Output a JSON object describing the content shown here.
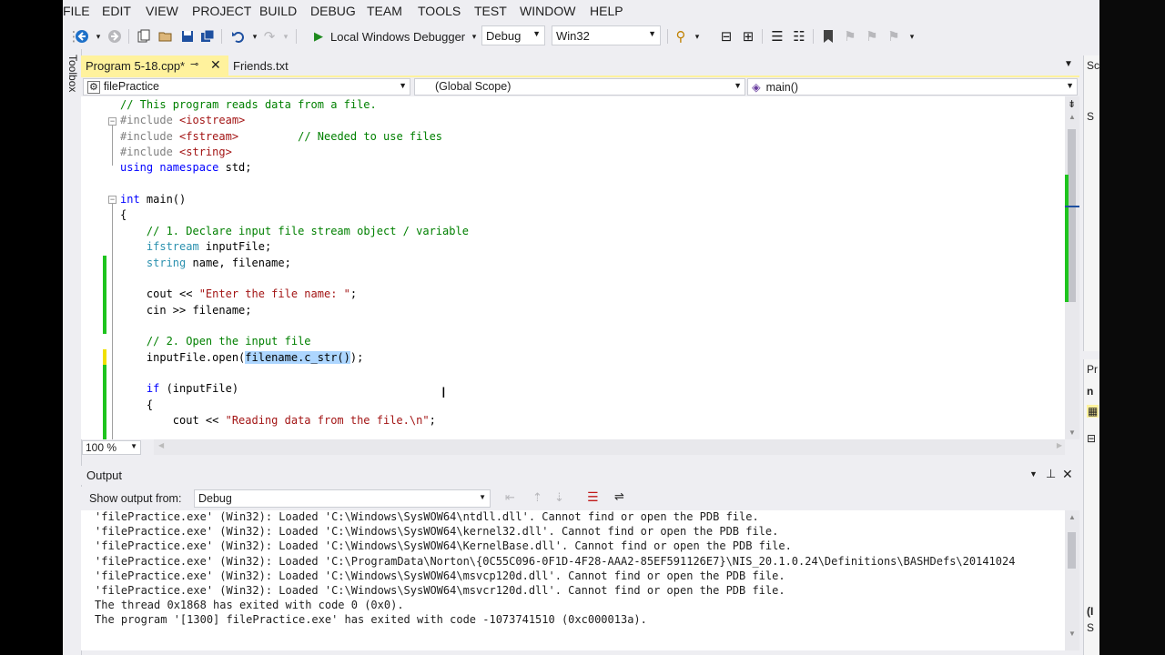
{
  "menu": [
    "FILE",
    "EDIT",
    "VIEW",
    "PROJECT",
    "BUILD",
    "DEBUG",
    "TEAM",
    "TOOLS",
    "TEST",
    "WINDOW",
    "HELP"
  ],
  "toolbar": {
    "run_label": "Local Windows Debugger",
    "config": "Debug",
    "platform": "Win32"
  },
  "toolbox_label": "Toolbox",
  "tabs": {
    "active": "Program 5-18.cpp*",
    "inactive": "Friends.txt"
  },
  "nav": {
    "project": "filePractice",
    "scope": "(Global Scope)",
    "member": "main()"
  },
  "code": [
    {
      "parts": [
        {
          "c": "cm",
          "t": "// This program reads data from a file."
        }
      ]
    },
    {
      "parts": [
        {
          "c": "pp",
          "t": "#include "
        },
        {
          "c": "str",
          "t": "<iostream>"
        }
      ]
    },
    {
      "parts": [
        {
          "c": "pp",
          "t": "#include "
        },
        {
          "c": "str",
          "t": "<fstream>"
        },
        {
          "c": "",
          "t": "         "
        },
        {
          "c": "cm",
          "t": "// Needed to use files"
        }
      ]
    },
    {
      "parts": [
        {
          "c": "pp",
          "t": "#include "
        },
        {
          "c": "str",
          "t": "<string>"
        }
      ]
    },
    {
      "parts": [
        {
          "c": "kw",
          "t": "using namespace"
        },
        {
          "c": "",
          "t": " std;"
        }
      ]
    },
    {
      "parts": []
    },
    {
      "parts": [
        {
          "c": "kw",
          "t": "int"
        },
        {
          "c": "",
          "t": " main()"
        }
      ]
    },
    {
      "parts": [
        {
          "c": "",
          "t": "{"
        }
      ]
    },
    {
      "parts": [
        {
          "c": "",
          "t": "    "
        },
        {
          "c": "cm",
          "t": "// 1. Declare input file stream object / variable"
        }
      ]
    },
    {
      "parts": [
        {
          "c": "",
          "t": "    "
        },
        {
          "c": "ty",
          "t": "ifstream"
        },
        {
          "c": "",
          "t": " inputFile;"
        }
      ]
    },
    {
      "parts": [
        {
          "c": "",
          "t": "    "
        },
        {
          "c": "ty",
          "t": "string"
        },
        {
          "c": "",
          "t": " name, filename;"
        }
      ]
    },
    {
      "parts": []
    },
    {
      "parts": [
        {
          "c": "",
          "t": "    cout << "
        },
        {
          "c": "str",
          "t": "\"Enter the file name: \""
        },
        {
          "c": "",
          "t": ";"
        }
      ]
    },
    {
      "parts": [
        {
          "c": "",
          "t": "    cin >> filename;"
        }
      ]
    },
    {
      "parts": []
    },
    {
      "parts": [
        {
          "c": "",
          "t": "    "
        },
        {
          "c": "cm",
          "t": "// 2. Open the input file"
        }
      ]
    },
    {
      "parts": [
        {
          "c": "",
          "t": "    inputFile.open("
        },
        {
          "c": "sel",
          "t": "filename.c_str()"
        },
        {
          "c": "",
          "t": ");"
        }
      ]
    },
    {
      "parts": []
    },
    {
      "parts": [
        {
          "c": "",
          "t": "    "
        },
        {
          "c": "kw",
          "t": "if"
        },
        {
          "c": "",
          "t": " (inputFile)"
        }
      ]
    },
    {
      "parts": [
        {
          "c": "",
          "t": "    {"
        }
      ]
    },
    {
      "parts": [
        {
          "c": "",
          "t": "        cout << "
        },
        {
          "c": "str",
          "t": "\"Reading data from the file.\\n\""
        },
        {
          "c": "",
          "t": ";"
        }
      ]
    }
  ],
  "zoom": "100 %",
  "output": {
    "title": "Output",
    "show_from_label": "Show output from:",
    "source": "Debug",
    "lines": [
      "'filePractice.exe' (Win32): Loaded 'C:\\Windows\\SysWOW64\\ntdll.dll'. Cannot find or open the PDB file.",
      "'filePractice.exe' (Win32): Loaded 'C:\\Windows\\SysWOW64\\kernel32.dll'. Cannot find or open the PDB file.",
      "'filePractice.exe' (Win32): Loaded 'C:\\Windows\\SysWOW64\\KernelBase.dll'. Cannot find or open the PDB file.",
      "'filePractice.exe' (Win32): Loaded 'C:\\ProgramData\\Norton\\{0C55C096-0F1D-4F28-AAA2-85EF591126E7}\\NIS_20.1.0.24\\Definitions\\BASHDefs\\20141024",
      "'filePractice.exe' (Win32): Loaded 'C:\\Windows\\SysWOW64\\msvcp120d.dll'. Cannot find or open the PDB file.",
      "'filePractice.exe' (Win32): Loaded 'C:\\Windows\\SysWOW64\\msvcr120d.dll'. Cannot find or open the PDB file.",
      "The thread 0x1868 has exited with code 0 (0x0).",
      "The program '[1300] filePractice.exe' has exited with code -1073741510 (0xc000013a)."
    ]
  },
  "right_panel_top": [
    "Sc",
    "S"
  ],
  "right_panel_bottom": [
    "Pr",
    "n",
    "(I",
    "S"
  ],
  "colors": {
    "accent_tab": "#fff29d",
    "change_saved": "#1ec41e",
    "change_unsaved": "#f0e000"
  }
}
